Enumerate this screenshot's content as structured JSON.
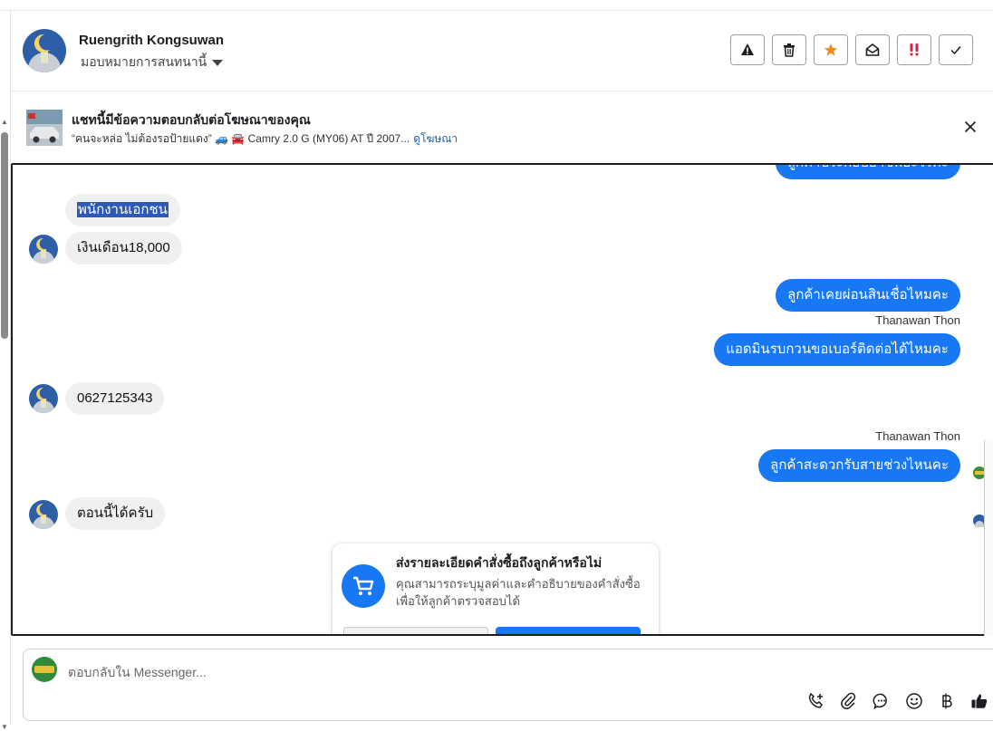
{
  "header": {
    "name": "Ruengrith Kongsuwan",
    "assign_label": "มอบหมายการสนทนานี้"
  },
  "ad": {
    "title": "แชทนี้มีข้อความตอบกลับต่อโฆษณาของคุณ",
    "subtitle": "“คนจะหล่อ ไม่ต้องรอป้ายแดง” 🚙 🚘 Camry 2.0 G (MY06) AT ปี 2007...",
    "link": "ดูโฆษณา"
  },
  "messages": [
    {
      "id": "m0",
      "direction": "out",
      "text": "ลูกค้าประกอบอาชีพอะไรคะ"
    },
    {
      "id": "m1",
      "direction": "in",
      "text": "พนักงานเอกชน",
      "selected": true
    },
    {
      "id": "m2",
      "direction": "in",
      "text": "เงินเดือน18,000"
    },
    {
      "id": "m3",
      "direction": "out",
      "text": "ลูกค้าเคยผ่อนสินเชื่อไหมคะ"
    },
    {
      "id": "m4",
      "direction": "out",
      "sender": "Thanawan Thon",
      "text": "แอดมินรบกวนขอเบอร์ติดต่อได้ไหมคะ"
    },
    {
      "id": "m5",
      "direction": "in",
      "text": "0627125343"
    },
    {
      "id": "m6",
      "direction": "out",
      "sender": "Thanawan Thon",
      "text": "ลูกค้าสะดวกรับสายช่วงไหนคะ"
    },
    {
      "id": "m7",
      "direction": "in",
      "text": "ตอนนี้ได้ครับ"
    }
  ],
  "order_card": {
    "title": "ส่งรายละเอียดคำสั่งซื้อถึงลูกค้าหรือไม่",
    "description": "คุณสามารถระบุมูลค่าและคำอธิบายของคำสั่งซื้อเพื่อให้ลูกค้าตรวจสอบได้"
  },
  "composer": {
    "placeholder": "ตอบกลับใน Messenger..."
  },
  "colors": {
    "accent": "#1877f2",
    "incoming_bubble": "#f0f0f0",
    "star": "#f28b20",
    "urgent": "#e41e3f"
  },
  "icons": [
    "warning-icon",
    "trash-icon",
    "star-icon",
    "envelope-open-icon",
    "exclamation-icon",
    "check-icon",
    "close-icon",
    "cart-icon",
    "phone-add-icon",
    "paperclip-icon",
    "chat-bubble-icon",
    "emoji-icon",
    "baht-icon",
    "thumbs-up-icon"
  ]
}
